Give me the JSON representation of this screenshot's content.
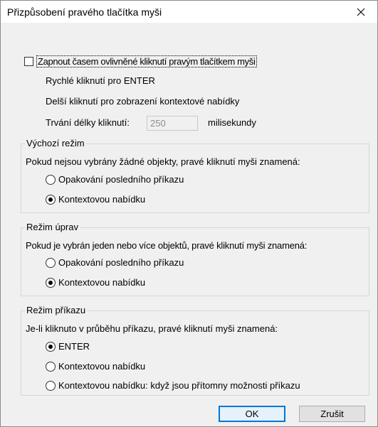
{
  "window": {
    "title": "Přizpůsobení pravého tlačítka myši"
  },
  "timed_click": {
    "checkbox_label": "Zapnout časem ovlivněné kliknutí pravým tlačítkem myši",
    "checked": false,
    "quick_click_text": "Rychlé kliknutí pro ENTER",
    "long_click_text": "Delší kliknutí pro zobrazení kontextové nabídky",
    "duration_label": "Trvání délky kliknutí:",
    "duration_value": "250",
    "duration_unit": "milisekundy"
  },
  "default_mode": {
    "title": "Výchozí režim",
    "description": "Pokud nejsou vybrány žádné objekty, pravé kliknutí myši znamená:",
    "options": [
      {
        "label": "Opakování posledního příkazu",
        "checked": false
      },
      {
        "label": "Kontextovou nabídku",
        "checked": true
      }
    ]
  },
  "edit_mode": {
    "title": "Režim úprav",
    "description": "Pokud je vybrán jeden nebo více objektů, pravé kliknutí myši znamená:",
    "options": [
      {
        "label": "Opakování posledního příkazu",
        "checked": false
      },
      {
        "label": "Kontextovou nabídku",
        "checked": true
      }
    ]
  },
  "command_mode": {
    "title": "Režim příkazu",
    "description": "Je-li kliknuto v průběhu příkazu, pravé kliknutí myši znamená:",
    "options": [
      {
        "label": "ENTER",
        "checked": true
      },
      {
        "label": "Kontextovou nabídku",
        "checked": false
      },
      {
        "label": "Kontextovou nabídku: když jsou přítomny možnosti příkazu",
        "checked": false
      }
    ]
  },
  "buttons": {
    "ok": "OK",
    "cancel": "Zrušit"
  },
  "colors": {
    "accent": "#0078d7",
    "dialog_bg": "#f0f0f0"
  }
}
